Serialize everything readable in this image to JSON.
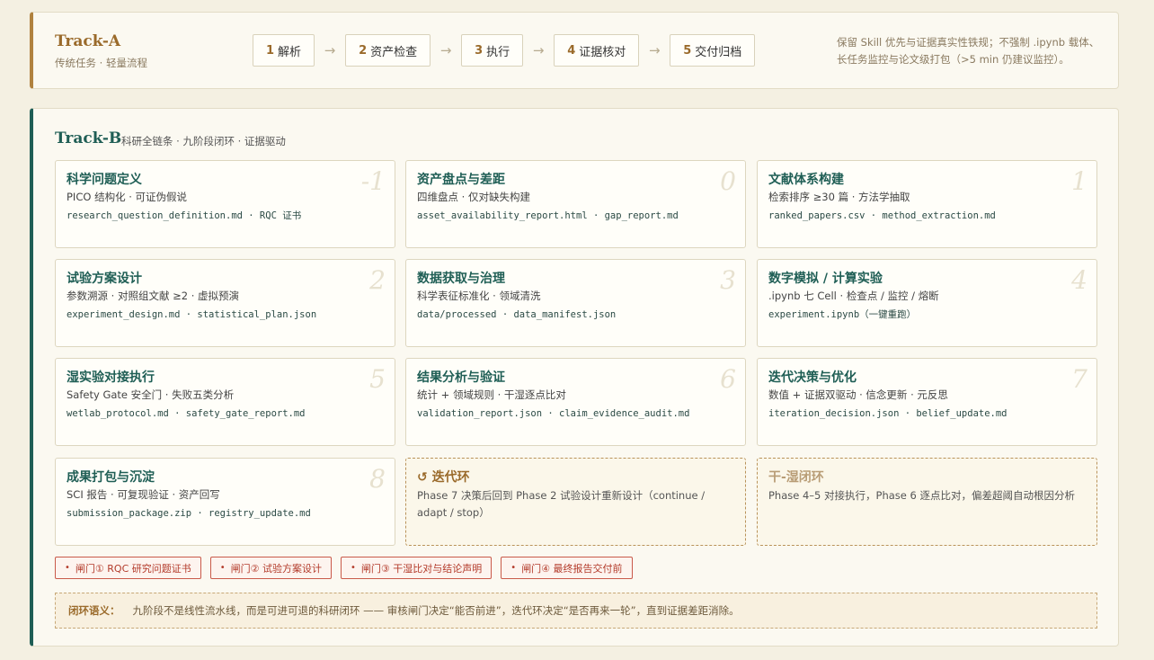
{
  "track_a": {
    "title": "Track-A",
    "subtitle": "传统任务 · 轻量流程",
    "steps": [
      {
        "num": "1",
        "label": "解析"
      },
      {
        "num": "2",
        "label": "资产检查"
      },
      {
        "num": "3",
        "label": "执行"
      },
      {
        "num": "4",
        "label": "证据核对"
      },
      {
        "num": "5",
        "label": "交付归档"
      }
    ],
    "arrow": "→",
    "note": "保留 Skill 优先与证据真实性铁规；不强制 .ipynb 载体、长任务监控与论文级打包（>5 min 仍建议监控）。"
  },
  "track_b": {
    "title": "Track-B",
    "subtitle": "科研全链条 · 九阶段闭环 · 证据驱动",
    "phases": [
      {
        "phase": "-1",
        "title": "科学问题定义",
        "subtitle": "PICO 结构化 · 可证伪假说",
        "files": "research_question_definition.md · RQC 证书"
      },
      {
        "phase": "0",
        "title": "资产盘点与差距",
        "subtitle": "四维盘点 · 仅对缺失构建",
        "files": "asset_availability_report.html · gap_report.md"
      },
      {
        "phase": "1",
        "title": "文献体系构建",
        "subtitle": "检索排序 ≥30 篇 · 方法学抽取",
        "files": "ranked_papers.csv · method_extraction.md"
      },
      {
        "phase": "2",
        "title": "试验方案设计",
        "subtitle": "参数溯源 · 对照组文献 ≥2 · 虚拟预演",
        "files": "experiment_design.md · statistical_plan.json"
      },
      {
        "phase": "3",
        "title": "数据获取与治理",
        "subtitle": "科学表征标准化 · 领域清洗",
        "files": "data/processed · data_manifest.json"
      },
      {
        "phase": "4",
        "title": "数字模拟 / 计算实验",
        "subtitle": ".ipynb 七 Cell · 检查点 / 监控 / 熔断",
        "files": "experiment.ipynb（一键重跑）"
      },
      {
        "phase": "5",
        "title": "湿实验对接执行",
        "subtitle": "Safety Gate 安全门 · 失败五类分析",
        "files": "wetlab_protocol.md · safety_gate_report.md"
      },
      {
        "phase": "6",
        "title": "结果分析与验证",
        "subtitle": "统计 + 领域规则 · 干湿逐点比对",
        "files": "validation_report.json · claim_evidence_audit.md"
      },
      {
        "phase": "7",
        "title": "迭代决策与优化",
        "subtitle": "数值 + 证据双驱动 · 信念更新 · 元反思",
        "files": "iteration_decision.json · belief_update.md"
      },
      {
        "phase": "8",
        "title": "成果打包与沉淀",
        "subtitle": "SCI 报告 · 可复现验证 · 资产回写",
        "files": "submission_package.zip · registry_update.md"
      }
    ],
    "loops": [
      {
        "title": "↺ 迭代环",
        "text": "Phase 7 决策后回到 Phase 2 试验设计重新设计（continue / adapt / stop）"
      },
      {
        "title": "干-湿闭环",
        "text": "Phase 4–5 对接执行，Phase 6 逐点比对，偏差超阈自动根因分析"
      }
    ],
    "gates": [
      "闸门① RQC 研究问题证书",
      "闸门② 试验方案设计",
      "闸门③ 干湿比对与结论声明",
      "闸门④ 最终报告交付前"
    ],
    "gate_bullet": "•",
    "closing": {
      "label": "闭环语义：",
      "text": "九阶段不是线性流水线，而是可进可退的科研闭环 —— 审核闸门决定“能否前进”，迭代环决定“是否再来一轮”，直到证据差距消除。"
    }
  }
}
